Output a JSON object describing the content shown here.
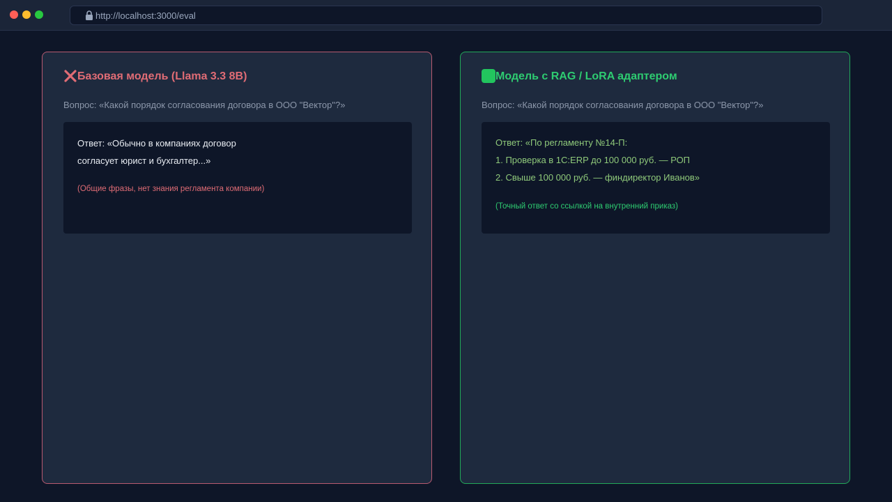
{
  "browser": {
    "url": "http://localhost:3000/eval"
  },
  "left_panel": {
    "icon": "cross-icon",
    "accent_color": "#e06c75",
    "title": "Базовая модель (Llama 3.3 8B)",
    "question": "Вопрос: «Какой порядок согласования договора в ООО \"Вектор\"?»",
    "answer_lines": [
      "Ответ: «Обычно в компаниях договор",
      "согласует юрист и бухгалтер...»"
    ],
    "note": "(Общие фразы, нет знания регламента компании)"
  },
  "right_panel": {
    "icon": "check-square-icon",
    "accent_color": "#2ecc71",
    "title": "Модель с RAG / LoRA адаптером",
    "question": "Вопрос: «Какой порядок согласования договора в ООО \"Вектор\"?»",
    "answer_lines": [
      "Ответ: «По регламенту №14-П:",
      "1. Проверка в 1С:ERP до 100 000 руб. — РОП",
      "2. Свыше 100 000 руб. — финдиректор Иванов»"
    ],
    "note": "(Точный ответ со ссылкой на внутренний приказ)"
  }
}
